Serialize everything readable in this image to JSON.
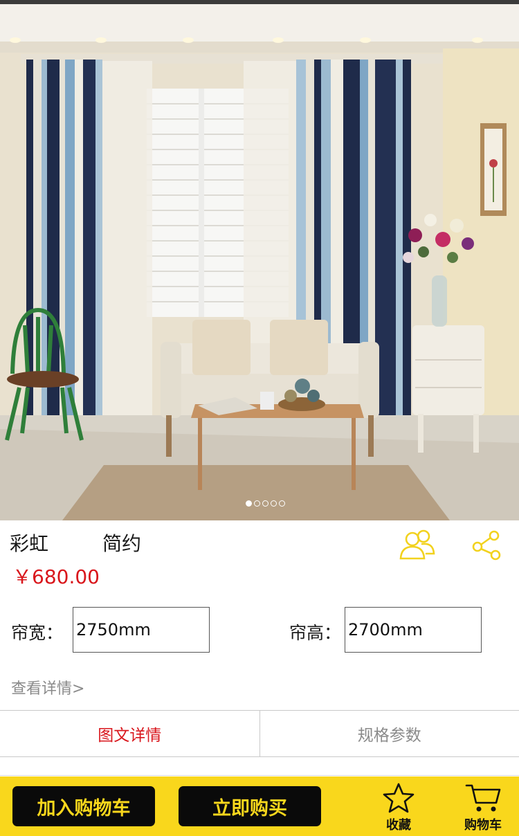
{
  "product": {
    "name_part1": "彩虹",
    "name_part2": "简约",
    "price": "￥680.00"
  },
  "carousel": {
    "total": 5,
    "active": 1
  },
  "options": {
    "width_label": "帘宽：",
    "width_value": "2750mm",
    "height_label": "帘高：",
    "height_value": "2700mm"
  },
  "detail_link": "查看详情>",
  "tabs": {
    "active": "图文详情",
    "inactive": "规格参数"
  },
  "bottom_bar": {
    "add_to_cart": "加入购物车",
    "buy_now": "立即购买",
    "favorite": "收藏",
    "cart": "购物车"
  },
  "icons": {
    "customer": "customer-service-icon",
    "share": "share-icon",
    "favorite": "star-icon",
    "cart": "shopping-cart-icon"
  },
  "colors": {
    "accent_yellow": "#f9d71c",
    "price_red": "#d9161c",
    "dark": "#0a0a0a"
  }
}
